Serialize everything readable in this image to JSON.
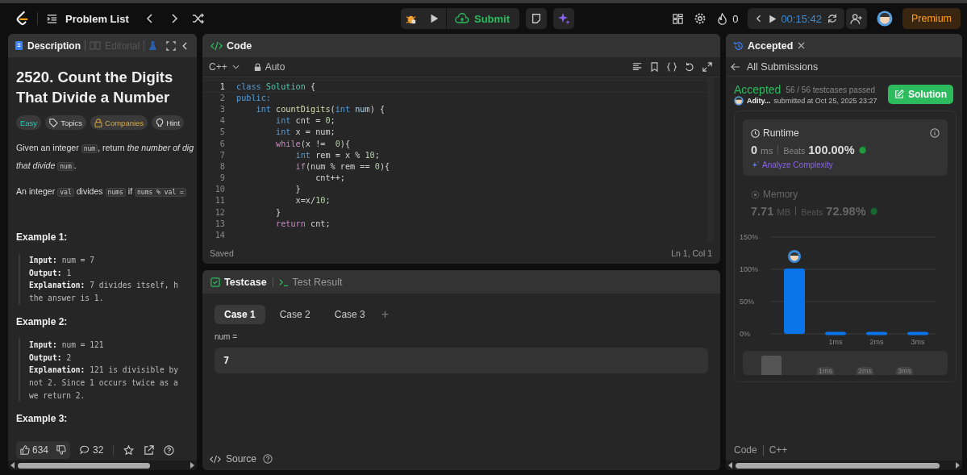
{
  "top_bar": {
    "problem_list": "Problem List",
    "submit": "Submit",
    "streak": "0",
    "timer": "00:15:42",
    "premium": "Premium"
  },
  "description_panel": {
    "tabs": [
      {
        "label": "Description",
        "selected": true,
        "disabled": false
      },
      {
        "label": "Editorial",
        "selected": false,
        "disabled": true
      }
    ],
    "title": "2520. Count the Digits That Divide a Number",
    "tags": [
      {
        "label": "Easy",
        "kind": "difficulty"
      },
      {
        "label": "Topics",
        "kind": "topics"
      },
      {
        "label": "Companies",
        "kind": "companies"
      },
      {
        "label": "Hint",
        "kind": "hint"
      }
    ],
    "paragraphs": [
      [
        [
          {
            "kind": "plain",
            "text": "Given an integer "
          },
          {
            "kind": "code",
            "text": "num"
          },
          {
            "kind": "plain",
            "text": ", return "
          },
          {
            "kind": "italic",
            "text": "the number of dig"
          }
        ],
        [
          {
            "kind": "italic",
            "text": "that divide "
          },
          {
            "kind": "code",
            "text": "num"
          },
          {
            "kind": "plain",
            "text": "."
          }
        ]
      ],
      [
        [
          {
            "kind": "plain",
            "text": "An integer "
          },
          {
            "kind": "code",
            "text": "val"
          },
          {
            "kind": "plain",
            "text": " divides "
          },
          {
            "kind": "code",
            "text": "nums"
          },
          {
            "kind": "plain",
            "text": " if "
          },
          {
            "kind": "code",
            "text": "nums % val ="
          }
        ]
      ]
    ],
    "examples": [
      {
        "title": "Example 1:",
        "lines": [
          {
            "label": "Input:",
            "text": "num = 7"
          },
          {
            "label": "Output:",
            "text": "1"
          },
          {
            "label": "Explanation:",
            "text": "7 divides itself, h"
          },
          {
            "text": "the answer is 1."
          }
        ]
      },
      {
        "title": "Example 2:",
        "lines": [
          {
            "label": "Input:",
            "text": "num = 121"
          },
          {
            "label": "Output:",
            "text": "2"
          },
          {
            "label": "Explanation:",
            "text": "121 is divisible by"
          },
          {
            "text": "not 2. Since 1 occurs twice as a"
          },
          {
            "text": "we return 2."
          }
        ]
      },
      {
        "title": "Example 3:"
      }
    ],
    "likes": "634",
    "comments": "32"
  },
  "code_panel": {
    "title": "Code",
    "language": "C++",
    "mode": "Auto",
    "status": "Saved",
    "cursor": "Ln 1, Col 1",
    "lines": [
      {
        "number": "1",
        "tokens": [
          {
            "kind": "keyword",
            "text": "class"
          },
          {
            "kind": "class",
            "text": " Solution"
          },
          {
            "kind": "plain",
            "text": " {"
          }
        ]
      },
      {
        "number": "2",
        "tokens": [
          {
            "kind": "keyword",
            "text": "public:"
          }
        ]
      },
      {
        "number": "3",
        "tokens": [
          {
            "kind": "keyword",
            "text": "    int"
          },
          {
            "kind": "function",
            "text": " countDigits"
          },
          {
            "kind": "plain",
            "text": "("
          },
          {
            "kind": "keyword",
            "text": "int"
          },
          {
            "kind": "param",
            "text": " num"
          },
          {
            "kind": "plain",
            "text": ") {"
          }
        ]
      },
      {
        "number": "4",
        "tokens": [
          {
            "kind": "keyword",
            "text": "        int"
          },
          {
            "kind": "plain",
            "text": " cnt = "
          },
          {
            "kind": "number",
            "text": "0"
          },
          {
            "kind": "plain",
            "text": ";"
          }
        ]
      },
      {
        "number": "5",
        "tokens": [
          {
            "kind": "keyword",
            "text": "        int"
          },
          {
            "kind": "plain",
            "text": " x = num;"
          }
        ]
      },
      {
        "number": "6",
        "tokens": [
          {
            "kind": "control",
            "text": "        while"
          },
          {
            "kind": "plain",
            "text": "(x !=  "
          },
          {
            "kind": "number",
            "text": "0"
          },
          {
            "kind": "plain",
            "text": "){"
          }
        ]
      },
      {
        "number": "7",
        "tokens": [
          {
            "kind": "keyword",
            "text": "            int"
          },
          {
            "kind": "plain",
            "text": " rem = x % "
          },
          {
            "kind": "number",
            "text": "10"
          },
          {
            "kind": "plain",
            "text": ";"
          }
        ]
      },
      {
        "number": "8",
        "tokens": [
          {
            "kind": "control",
            "text": "            if"
          },
          {
            "kind": "plain",
            "text": "(num % rem == "
          },
          {
            "kind": "number",
            "text": "0"
          },
          {
            "kind": "plain",
            "text": "){"
          }
        ]
      },
      {
        "number": "9",
        "tokens": [
          {
            "kind": "plain",
            "text": "                cnt++;"
          }
        ]
      },
      {
        "number": "10",
        "tokens": [
          {
            "kind": "plain",
            "text": "            }"
          }
        ]
      },
      {
        "number": "11",
        "tokens": [
          {
            "kind": "plain",
            "text": "            x=x/"
          },
          {
            "kind": "number",
            "text": "10"
          },
          {
            "kind": "plain",
            "text": ";"
          }
        ]
      },
      {
        "number": "12",
        "tokens": [
          {
            "kind": "plain",
            "text": "        }"
          }
        ]
      },
      {
        "number": "13",
        "tokens": [
          {
            "kind": "control",
            "text": "        return"
          },
          {
            "kind": "plain",
            "text": " cnt;"
          }
        ]
      },
      {
        "number": "14"
      }
    ]
  },
  "testcase_panel": {
    "tabs": [
      {
        "label": "Testcase",
        "selected": true
      },
      {
        "label": "Test Result",
        "selected": false
      }
    ],
    "cases": [
      {
        "label": "Case 1",
        "selected": true
      },
      {
        "label": "Case 2",
        "selected": false
      },
      {
        "label": "Case 3",
        "selected": false
      }
    ],
    "add": "+",
    "input_label": "num =",
    "input_value": "7",
    "source": "Source"
  },
  "submission_panel": {
    "tab": "Accepted",
    "back": "All Submissions",
    "status": "Accepted",
    "passed": "56 / 56 testcases passed",
    "user": "Adity...",
    "submitted": "submitted at Oct 25, 2025 23:27",
    "solution_button": "Solution",
    "metrics": [
      {
        "title": "Runtime",
        "kind": "runtime",
        "selected": true,
        "value": "0",
        "unit": "ms",
        "beats_label": "Beats",
        "beats": "100.00%",
        "analyze": "Analyze Complexity"
      },
      {
        "title": "Memory",
        "kind": "memory",
        "selected": false,
        "value": "7.71",
        "unit": "MB",
        "beats_label": "Beats",
        "beats": "72.98%"
      }
    ],
    "chart_data": {
      "type": "bar",
      "categories": [
        null,
        "1ms",
        "2ms",
        "3ms"
      ],
      "values": [
        100,
        2,
        2,
        2
      ],
      "ylim": [
        0,
        150
      ],
      "yticks": [
        {
          "value": 0,
          "label": "0%"
        },
        {
          "value": 50,
          "label": "50%"
        },
        {
          "value": 100,
          "label": "100%"
        },
        {
          "value": 150,
          "label": "150%"
        }
      ]
    },
    "range_labels": [
      "1ms",
      "2ms",
      "3ms"
    ],
    "footer_tabs": [
      "Code",
      "C++"
    ]
  }
}
